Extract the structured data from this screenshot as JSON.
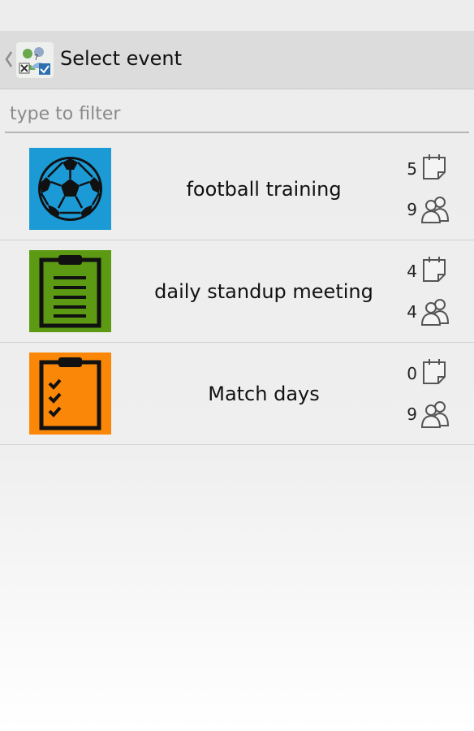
{
  "action_bar": {
    "title": "Select event"
  },
  "filter": {
    "placeholder": "type to filter",
    "value": ""
  },
  "events": [
    {
      "name": "football training",
      "dates_count": "5",
      "people_count": "9",
      "icon": "soccer-ball-icon",
      "color": "#1c9ad6"
    },
    {
      "name": "daily standup meeting",
      "dates_count": "4",
      "people_count": "4",
      "icon": "clipboard-list-icon",
      "color": "#5b9a12"
    },
    {
      "name": "Match days",
      "dates_count": "0",
      "people_count": "9",
      "icon": "clipboard-check-icon",
      "color": "#fb8708"
    }
  ]
}
